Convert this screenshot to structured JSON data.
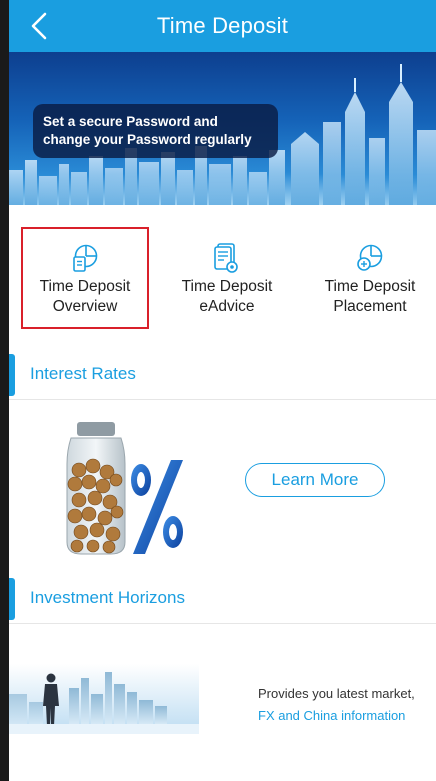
{
  "header": {
    "title": "Time Deposit",
    "back_icon": "chevron-left-icon"
  },
  "banner": {
    "message_line1": "Set a secure Password and",
    "message_line2": "change your Password regularly"
  },
  "features": [
    {
      "label_line1": "Time Deposit",
      "label_line2": "Overview",
      "icon": "pie-chart-document-icon",
      "selected": true
    },
    {
      "label_line1": "Time Deposit",
      "label_line2": "eAdvice",
      "icon": "document-advice-icon",
      "selected": false
    },
    {
      "label_line1": "Time Deposit",
      "label_line2": "Placement",
      "icon": "pie-chart-add-icon",
      "selected": false
    }
  ],
  "sections": {
    "interest_rates": {
      "title": "Interest Rates",
      "button": "Learn More"
    },
    "investment_horizons": {
      "title": "Investment Horizons",
      "text_line1": "Provides you latest market,",
      "text_line2": "FX and China information"
    }
  },
  "colors": {
    "primary": "#1a9ee0",
    "highlight": "#d9202a",
    "text": "#222222"
  }
}
